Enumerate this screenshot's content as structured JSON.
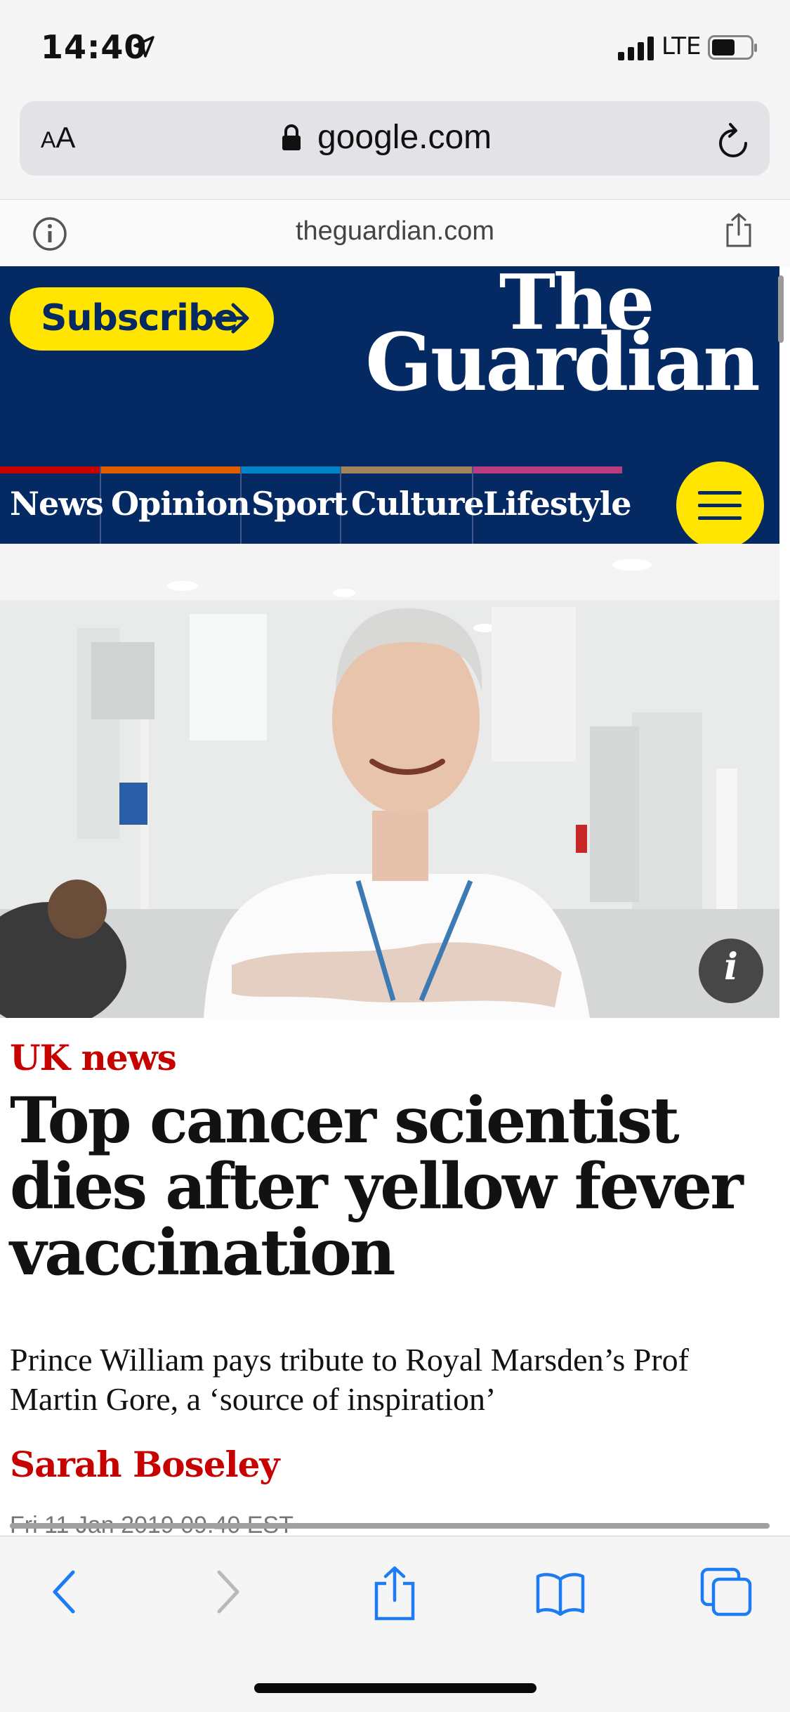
{
  "status_bar": {
    "time": "14:40",
    "network": "LTE",
    "icons": [
      "location-arrow-icon",
      "signal-bars-icon",
      "battery-icon"
    ]
  },
  "browser": {
    "text_size_small": "A",
    "text_size_large": "A",
    "url": "google.com",
    "site_domain": "theguardian.com",
    "icons": [
      "lock-icon",
      "reload-icon",
      "info-icon",
      "share-icon"
    ]
  },
  "guardian_header": {
    "subscribe_label": "Subscribe",
    "logo_line1": "The",
    "logo_line2": "Guardian",
    "colors": {
      "brand_blue": "#052962",
      "yellow": "#ffe500"
    }
  },
  "nav": {
    "items": [
      {
        "label": "News",
        "color": "#c70000"
      },
      {
        "label": "Opinion",
        "color": "#e05e00"
      },
      {
        "label": "Sport",
        "color": "#0084c6"
      },
      {
        "label": "Culture",
        "color": "#a1845c"
      },
      {
        "label": "Lifestyle",
        "color": "#bb3b80"
      }
    ],
    "menu_icon": "hamburger-menu-icon"
  },
  "article": {
    "image_info_glyph": "i",
    "section": "UK news",
    "headline": "Top cancer scientist dies after yellow fever vaccination",
    "standfirst": "Prince William pays tribute to Royal Marsden’s Prof Martin Gore, a ‘source of inspiration’",
    "byline": "Sarah Boseley",
    "dateline": "Fri 11 Jan 2019 09.40 EST"
  },
  "toolbar": {
    "icons": [
      "back-icon",
      "forward-icon",
      "share-icon",
      "bookmarks-icon",
      "tabs-icon"
    ]
  }
}
